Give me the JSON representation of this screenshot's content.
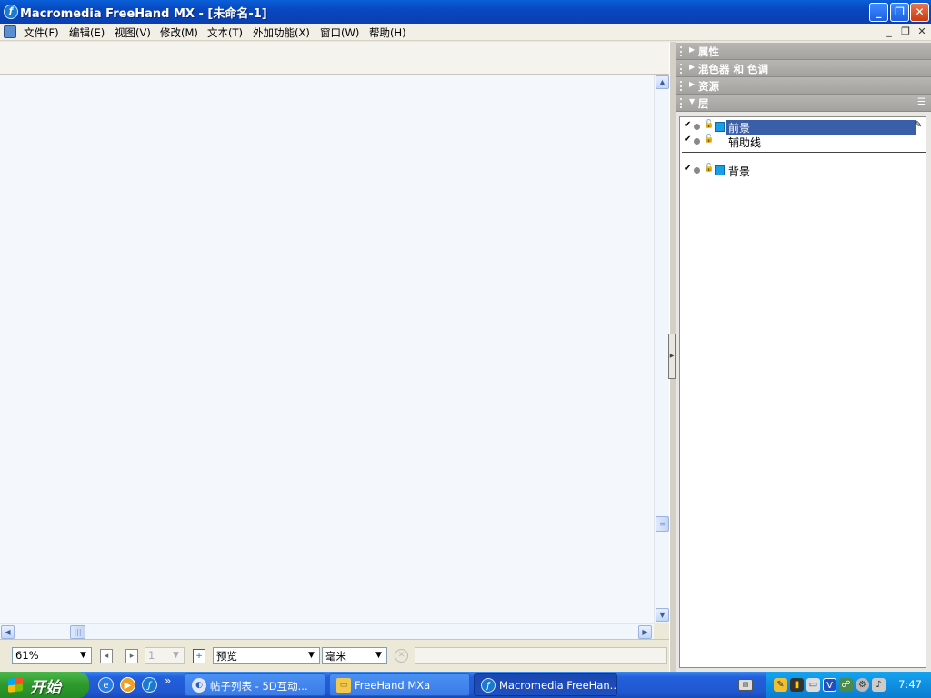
{
  "window": {
    "title": "Macromedia FreeHand MX - [未命名-1]",
    "app_icon_glyph": "ƒ"
  },
  "window_controls": {
    "minimize": "_",
    "restore": "❐",
    "close": "✕"
  },
  "menu": {
    "items": [
      "文件(F)",
      "编辑(E)",
      "视图(V)",
      "修改(M)",
      "文本(T)",
      "外加功能(X)",
      "窗口(W)",
      "帮助(H)"
    ],
    "doc_controls": {
      "minimize": "_",
      "restore": "❐",
      "close": "✕"
    }
  },
  "status_bar": {
    "zoom": "61%",
    "page_number": "1",
    "view_mode": "预览",
    "units": "毫米"
  },
  "panels": {
    "headers": [
      {
        "title": "属性",
        "expanded": false
      },
      {
        "title": "混色器 和 色调",
        "expanded": false
      },
      {
        "title": "资源",
        "expanded": false
      },
      {
        "title": "层",
        "expanded": true
      }
    ],
    "layers": {
      "top": [
        {
          "name": "前景",
          "selected": true,
          "color": "#1a9ee8"
        },
        {
          "name": "辅助线",
          "selected": false
        }
      ],
      "bottom": [
        {
          "name": "背景",
          "selected": false,
          "color": "#1a9ee8"
        }
      ]
    }
  },
  "taskbar": {
    "start_label": "开始",
    "quicklaunch": [
      "ie-icon",
      "media-player-icon",
      "freehand-icon"
    ],
    "chevron": "»",
    "tasks": [
      {
        "label": "帖子列表 - 5D互动...",
        "active": false
      },
      {
        "label": "FreeHand MXa",
        "active": false
      },
      {
        "label": "Macromedia FreeHan...",
        "active": true
      }
    ],
    "clock": "7:47"
  }
}
